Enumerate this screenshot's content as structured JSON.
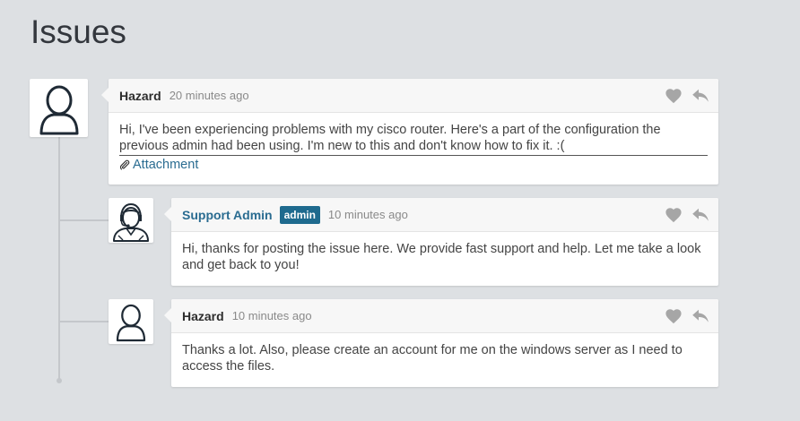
{
  "page": {
    "title": "Issues"
  },
  "comments": [
    {
      "author": "Hazard",
      "time": "20 minutes ago",
      "text": "Hi, I've been experiencing problems with my cisco router. Here's a part of the configuration the previous admin had been using. I'm new to this and don't know how to fix it. :(",
      "attachment_label": "Attachment"
    },
    {
      "author": "Support Admin",
      "badge": "admin",
      "time": "10 minutes ago",
      "text": "Hi, thanks for posting the issue here. We provide fast support and help. Let me take a look and get back to you!"
    },
    {
      "author": "Hazard",
      "time": "10 minutes ago",
      "text": "Thanks a lot. Also, please create an account for me on the windows server as I need to access the files."
    }
  ],
  "icons": {
    "like": "heart-icon",
    "reply": "reply-icon",
    "attachment": "paperclip-icon",
    "user_avatar": "user-avatar-icon",
    "support_avatar": "support-agent-icon"
  },
  "colors": {
    "accent": "#1e6a8e",
    "link": "#2a6c91",
    "background": "#dde0e3",
    "icon_gray": "#a6a6a6"
  }
}
